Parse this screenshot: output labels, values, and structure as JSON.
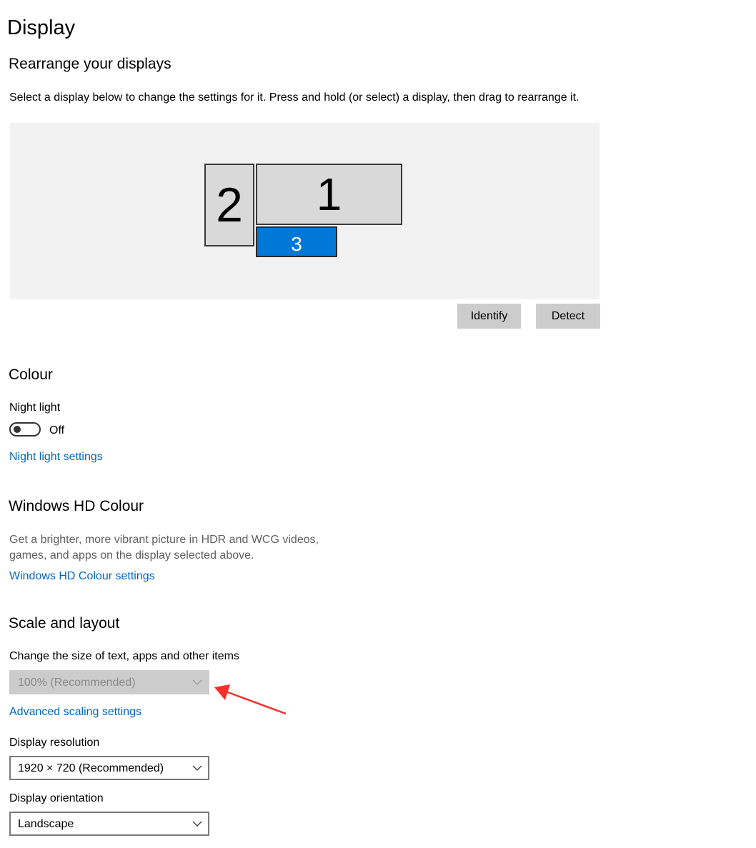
{
  "header": {
    "title": "Display"
  },
  "rearrange": {
    "title": "Rearrange your displays",
    "description": "Select a display below to change the settings for it. Press and hold (or select) a display, then drag to rearrange it.",
    "displays": [
      {
        "number": "2",
        "selected": false
      },
      {
        "number": "1",
        "selected": false
      },
      {
        "number": "3",
        "selected": true
      }
    ],
    "identify_label": "Identify",
    "detect_label": "Detect",
    "selected_color": "#0078d7"
  },
  "colour": {
    "title": "Colour",
    "night_light_label": "Night light",
    "night_light_state": "Off",
    "night_light_settings_link": "Night light settings"
  },
  "hd_colour": {
    "title": "Windows HD Colour",
    "description_line1": "Get a brighter, more vibrant picture in HDR and WCG videos,",
    "description_line2": "games, and apps on the display selected above.",
    "settings_link": "Windows HD Colour settings"
  },
  "scale_layout": {
    "title": "Scale and layout",
    "scale_label": "Change the size of text, apps and other items",
    "scale_value": "100% (Recommended)",
    "advanced_link": "Advanced scaling settings",
    "resolution_label": "Display resolution",
    "resolution_value": "1920 × 720 (Recommended)",
    "orientation_label": "Display orientation",
    "orientation_value": "Landscape"
  },
  "annotation": {
    "arrow_color": "#f5302a"
  },
  "accent_color": "#0067c0"
}
